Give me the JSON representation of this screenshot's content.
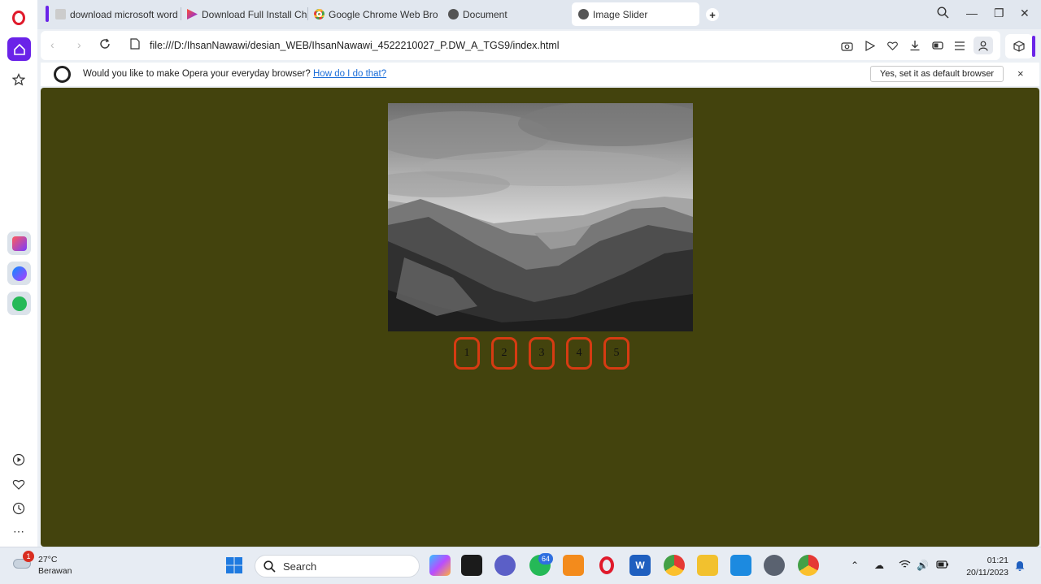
{
  "colors": {
    "page_background": "#43430d",
    "dot_border": "#d63b12",
    "opera_accent": "#6a23e8",
    "link": "#1a6dd8"
  },
  "tabs": [
    {
      "label": "download microsoft word",
      "icon": "generic-favicon"
    },
    {
      "label": "Download Full Install Chro",
      "icon": "play-favicon"
    },
    {
      "label": "Google Chrome Web Brow",
      "icon": "chrome-favicon"
    },
    {
      "label": "Document",
      "icon": "globe-favicon"
    },
    {
      "label": "Image Slider",
      "icon": "globe-favicon",
      "active": true
    }
  ],
  "address": {
    "url": "file:///D:/IhsanNawawi/desian_WEB/IhsanNawawi_4522210027_P.DW_A_TGS9/index.html"
  },
  "infobar": {
    "message": "Would you like to make Opera your everyday browser?",
    "link": "How do I do that?",
    "button": "Yes, set it as default browser",
    "close": "×"
  },
  "page": {
    "slider_image": "black-and-white mountain valley landscape",
    "dots": [
      "1",
      "2",
      "3",
      "4",
      "5"
    ]
  },
  "taskbar": {
    "weather_temp": "27°C",
    "weather_desc": "Berawan",
    "weather_badge": "1",
    "search_placeholder": "Search",
    "whatsapp_badge": "64",
    "time": "01:21",
    "date": "20/11/2023"
  }
}
